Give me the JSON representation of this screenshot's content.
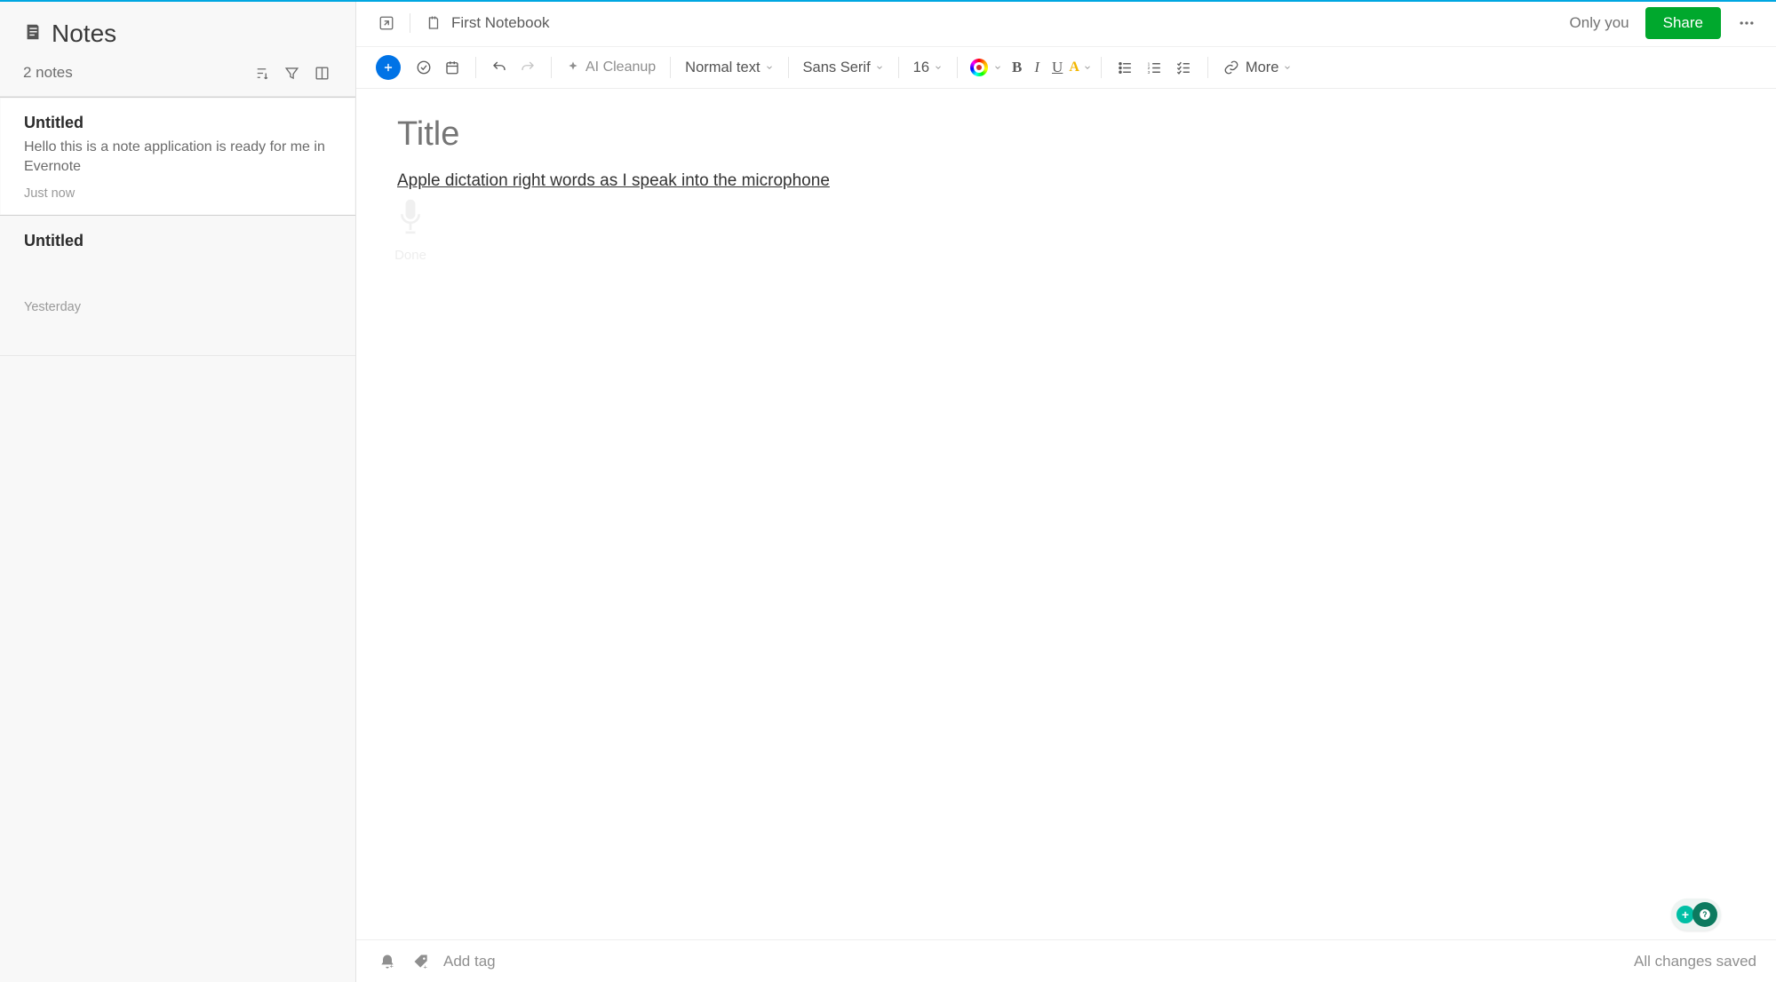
{
  "sidebar": {
    "title": "Notes",
    "count_label": "2 notes",
    "notes": [
      {
        "title": "Untitled",
        "preview": "Hello this is a note application is ready for me in Evernote",
        "meta": "Just now",
        "selected": true
      },
      {
        "title": "Untitled",
        "preview": "",
        "meta": "Yesterday",
        "selected": false
      }
    ]
  },
  "header": {
    "notebook_label": "First Notebook",
    "only_you": "Only you",
    "share": "Share"
  },
  "toolbar": {
    "ai_cleanup": "AI Cleanup",
    "paragraph_style": "Normal text",
    "font_family": "Sans Serif",
    "font_size": "16",
    "more": "More"
  },
  "editor": {
    "title_placeholder": "Title",
    "body_text": "Apple dictation right words as I speak into the microphone",
    "dictation_done": "Done"
  },
  "footer": {
    "add_tag_placeholder": "Add tag",
    "status": "All changes saved"
  },
  "colors": {
    "accent": "#00a7e1",
    "share_button": "#00a82d",
    "insert_button": "#0073e6"
  }
}
